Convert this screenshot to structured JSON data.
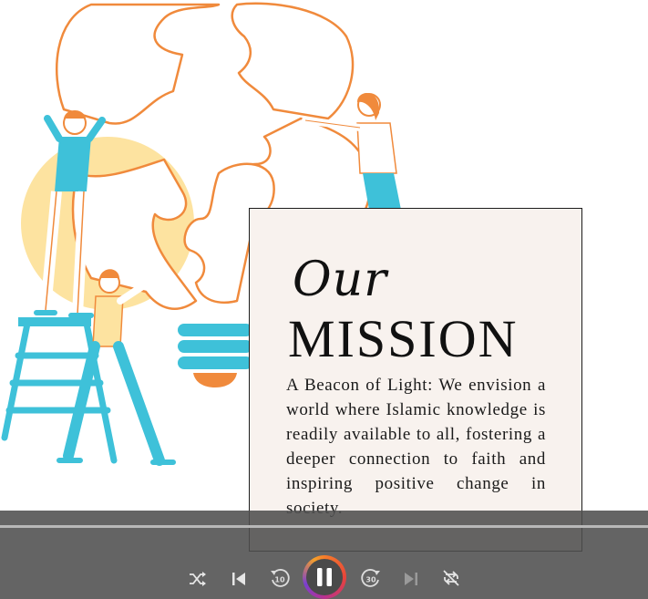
{
  "card": {
    "title_line1": "Our",
    "title_line2": "MISSION",
    "body": "A Beacon of Light: We envision a world where Islamic knowledge is readily available to all, fostering a deeper connection to faith and inspiring positive change in society."
  },
  "player": {
    "progress": 0,
    "skip_back_seconds": "10",
    "skip_forward_seconds": "30",
    "state": "playing",
    "icons": [
      "shuffle-icon",
      "previous-icon",
      "rewind-10-icon",
      "pause-icon",
      "forward-30-icon",
      "next-icon",
      "repeat-off-icon"
    ]
  },
  "colors": {
    "orange": "#f08a3c",
    "teal": "#3ec1d9",
    "yellow": "#fde3a0",
    "card_bg": "#f8f2ee",
    "player_bg": "#4e4e4e"
  }
}
